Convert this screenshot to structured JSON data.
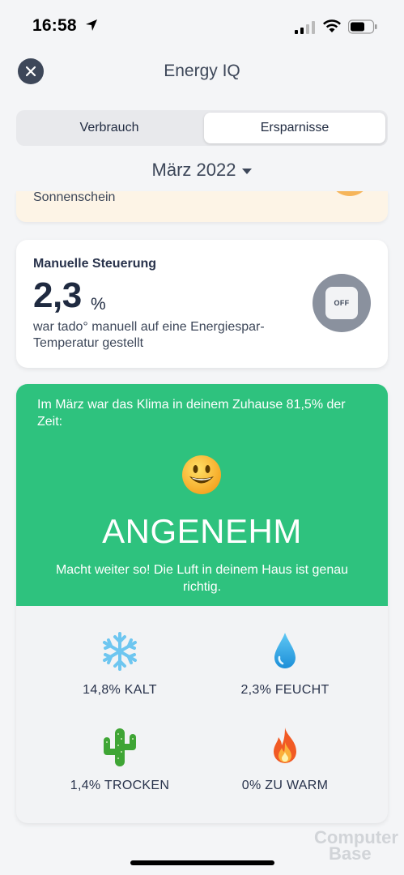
{
  "status_bar": {
    "time": "16:58"
  },
  "header": {
    "title": "Energy IQ"
  },
  "tabs": {
    "left": "Verbrauch",
    "right": "Ersparnisse",
    "active": "right"
  },
  "month_selector": {
    "label": "März 2022"
  },
  "sunshine_card": {
    "text": "Sonnenschein"
  },
  "manual_card": {
    "title": "Manuelle Steuerung",
    "value": "2,3",
    "unit": "%",
    "description": "war tado° manuell auf eine Energiespar-Temperatur gestellt",
    "toggle_label": "OFF"
  },
  "climate_card": {
    "intro": "Im März war das Klima in deinem Zuhause 81,5% der Zeit:",
    "status": "ANGENEHM",
    "advice": "Macht weiter so! Die Luft in deinem Haus ist genau richtig.",
    "colors": {
      "accent": "#2ec27e"
    },
    "stats": [
      {
        "icon": "snowflake-icon",
        "label": "14,8% KALT"
      },
      {
        "icon": "droplet-icon",
        "label": "2,3% FEUCHT"
      },
      {
        "icon": "cactus-icon",
        "label": "1,4% TROCKEN"
      },
      {
        "icon": "fire-icon",
        "label": "0% ZU WARM"
      }
    ]
  },
  "watermark": {
    "line1": "Computer",
    "line2": "Base"
  }
}
